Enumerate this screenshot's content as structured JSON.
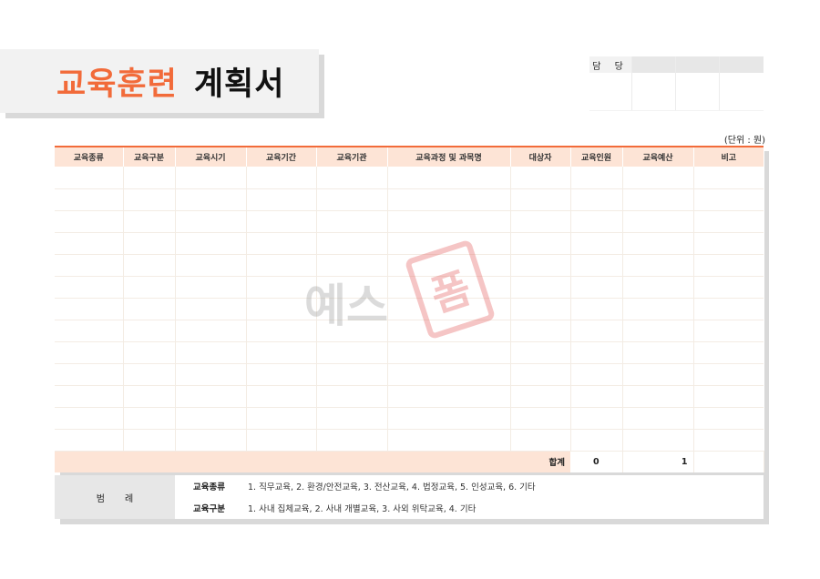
{
  "title": {
    "accent": "교육훈련",
    "rest": "계획서"
  },
  "approval": {
    "label": "담 당"
  },
  "unit": "(단위 : 원)",
  "table": {
    "columns": [
      "교육종류",
      "교육구분",
      "교육시기",
      "교육기간",
      "교육기관",
      "교육과정 및 과목명",
      "대상자",
      "교육인원",
      "교육예산",
      "비고"
    ],
    "empty_rows": 13,
    "sum": {
      "label": "합계",
      "people": "0",
      "budget": "1"
    }
  },
  "legend": {
    "title": "범례",
    "rows": [
      {
        "key": "교육종류",
        "value": "1. 직무교육, 2. 환경/안전교육, 3. 전산교육, 4. 법정교육, 5. 인성교육, 6. 기타"
      },
      {
        "key": "교육구분",
        "value": "1. 사내 집체교육, 2. 사내 개별교육, 3. 사외 위탁교육, 4. 기타"
      }
    ]
  },
  "watermark": {
    "text": "예스",
    "stamp": "폼"
  },
  "colors": {
    "accent": "#f26b3a",
    "header_bg": "#fde4d6",
    "legend_bg": "#e7e7e7"
  }
}
